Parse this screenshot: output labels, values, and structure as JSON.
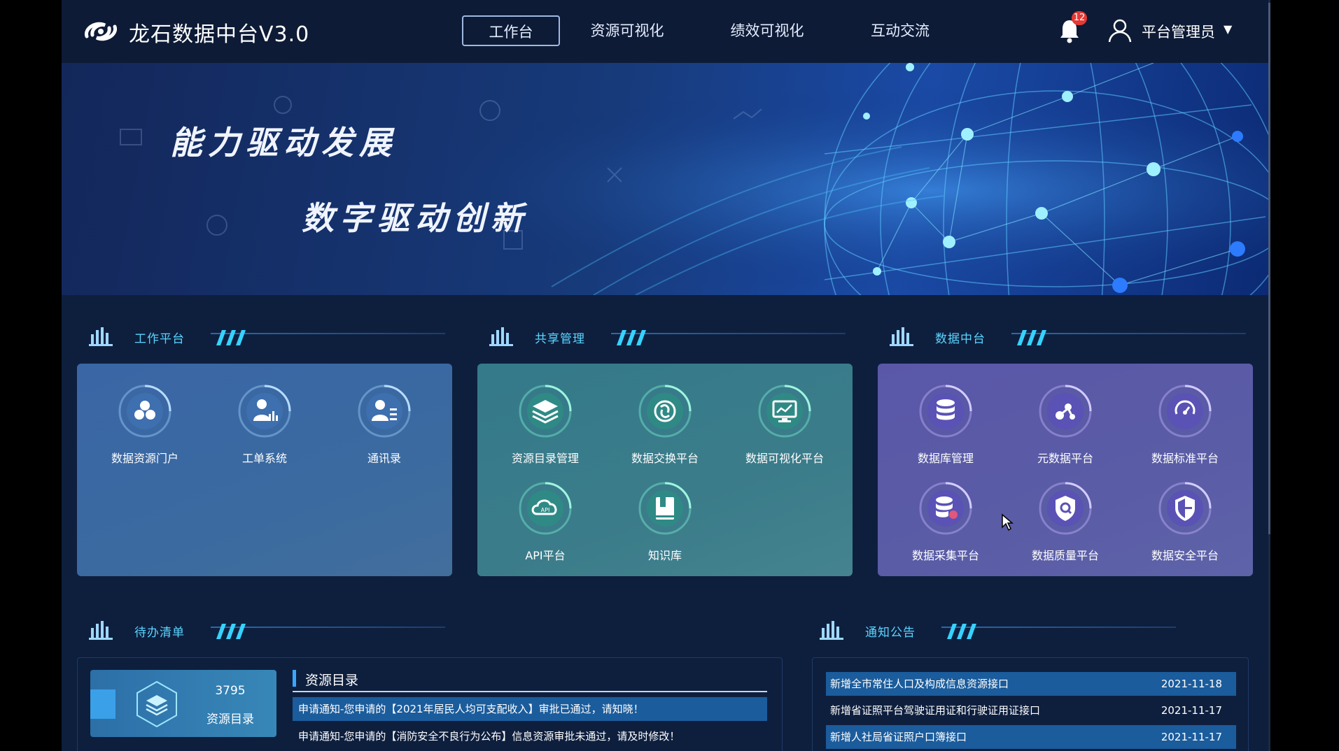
{
  "header": {
    "title": "龙石数据中台V3.0",
    "nav": [
      {
        "label": "工作台",
        "active": true
      },
      {
        "label": "资源可视化",
        "active": false
      },
      {
        "label": "绩效可视化",
        "active": false
      },
      {
        "label": "互动交流",
        "active": false
      }
    ],
    "notification_count": "12",
    "user_name": "平台管理员",
    "icons": [
      "logo-mark",
      "bell-icon",
      "user-icon",
      "caret-down-icon"
    ]
  },
  "banner": {
    "line1": "能力驱动发展",
    "line2": "数字驱动创新"
  },
  "sections": {
    "work_platform": {
      "title": "工作平台",
      "items": [
        {
          "label": "数据资源门户",
          "icon": "portal-icon"
        },
        {
          "label": "工单系统",
          "icon": "work-order-icon"
        },
        {
          "label": "通讯录",
          "icon": "contacts-icon"
        }
      ]
    },
    "share_management": {
      "title": "共享管理",
      "items": [
        {
          "label": "资源目录管理",
          "icon": "layers-icon"
        },
        {
          "label": "数据交换平台",
          "icon": "exchange-icon"
        },
        {
          "label": "数据可视化平台",
          "icon": "monitor-chart-icon"
        },
        {
          "label": "API平台",
          "icon": "api-cloud-icon"
        },
        {
          "label": "知识库",
          "icon": "book-icon"
        }
      ]
    },
    "data_center": {
      "title": "数据中台",
      "items": [
        {
          "label": "数据库管理",
          "icon": "database-icon"
        },
        {
          "label": "元数据平台",
          "icon": "nodes-icon"
        },
        {
          "label": "数据标准平台",
          "icon": "gauge-icon"
        },
        {
          "label": "数据采集平台",
          "icon": "database-collect-icon"
        },
        {
          "label": "数据质量平台",
          "icon": "quality-shield-icon"
        },
        {
          "label": "数据安全平台",
          "icon": "security-shield-icon"
        }
      ]
    },
    "todo": {
      "title": "待办清单",
      "stat_count": "3795",
      "stat_label": "资源目录",
      "list_title": "资源目录",
      "items": [
        "申请通知-您申请的【2021年居民人均可支配收入】审批已通过，请知晓！",
        "申请通知-您申请的【消防安全不良行为公布】信息资源审批未通过，请及时修改！"
      ]
    },
    "notices": {
      "title": "通知公告",
      "items": [
        {
          "text": "新增全市常住人口及构成信息资源接口",
          "date": "2021-11-18"
        },
        {
          "text": "新增省证照平台驾驶证用证和行驶证用证接口",
          "date": "2021-11-17"
        },
        {
          "text": "新增人社局省证照户口簿接口",
          "date": "2021-11-17"
        }
      ]
    }
  },
  "colors": {
    "accent": "#5bd5ff",
    "panel_blue": "#3d6aa8",
    "panel_teal": "#3a7c8c",
    "panel_purple": "#5a5aa6",
    "badge": "#e53935"
  }
}
